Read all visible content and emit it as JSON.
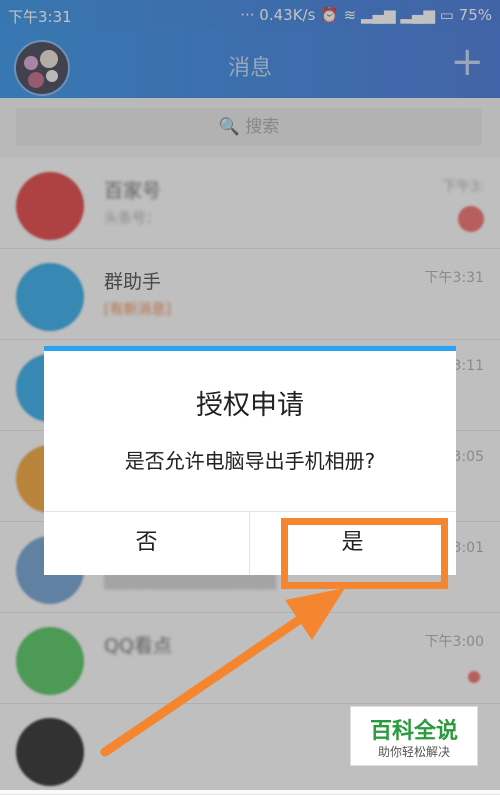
{
  "status": {
    "time": "下午3:31",
    "right": "··· 0.43K/s ⏰ ≋ ▂▄▆ ▂▄▆ ▭ 75%"
  },
  "header": {
    "title": "消息",
    "plus_icon": "plus-icon"
  },
  "search": {
    "placeholder": "🔍 搜索"
  },
  "conversations": [
    {
      "name": "百家号",
      "message": "头条号：",
      "time": "下午3:",
      "badge_color": "#e06060",
      "avatar_color": "#e03a3a"
    },
    {
      "name": "群助手",
      "message": "[有新消息]",
      "time": "下午3:31",
      "avatar_color": "#2aa6e6"
    },
    {
      "name": "",
      "message": "",
      "time": "3:11",
      "avatar_color": "#2aa6e6"
    },
    {
      "name": "",
      "message": "",
      "time": "3:05",
      "avatar_color": "#f0a030"
    },
    {
      "name": "",
      "message": "",
      "time": "3:01",
      "avatar_color": "#6a9cd0"
    },
    {
      "name": "QQ看点",
      "message": "",
      "time": "下午3:00",
      "avatar_color": "#4cc05a"
    },
    {
      "name": "",
      "message": "",
      "time": "",
      "avatar_color": "#222222"
    }
  ],
  "dialog": {
    "title": "授权申请",
    "message": "是否允许电脑导出手机相册?",
    "no_label": "否",
    "yes_label": "是"
  },
  "watermark": {
    "title": "百科全说",
    "subtitle": "助你轻松解决"
  },
  "colors": {
    "accent": "#2aa3f2",
    "highlight": "#f5862f"
  }
}
